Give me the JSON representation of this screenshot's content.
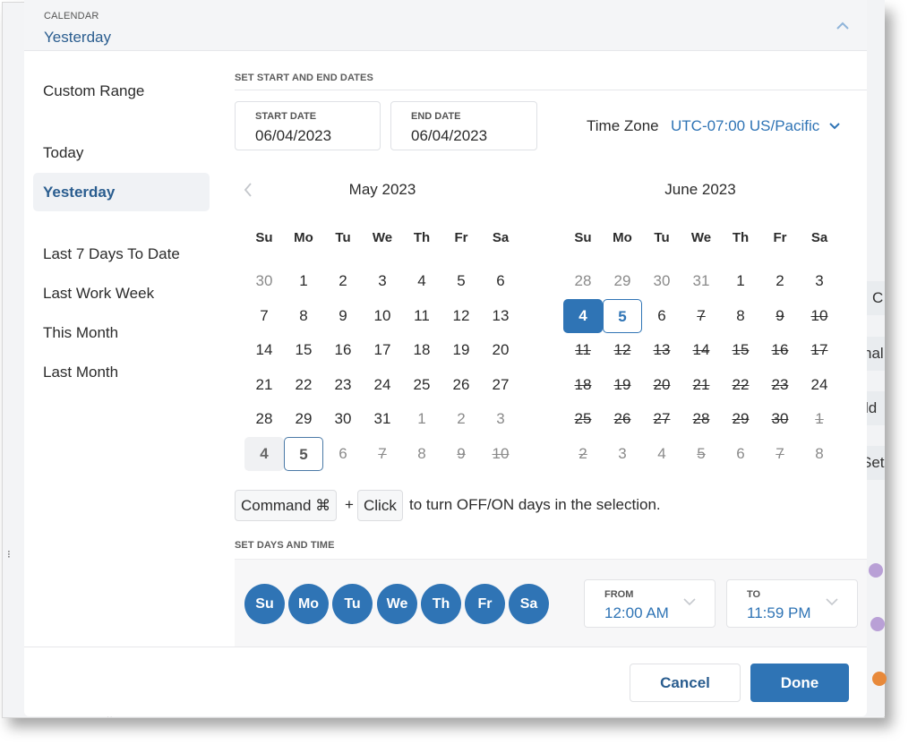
{
  "header": {
    "label": "CALENDAR",
    "value": "Yesterday",
    "collapse_icon": "chevron-up-icon"
  },
  "sidebar": {
    "items": [
      {
        "label": "Custom Range",
        "active": false
      },
      {
        "label": "Today",
        "active": false
      },
      {
        "label": "Yesterday",
        "active": true
      },
      {
        "label": "Last 7 Days To Date",
        "active": false
      },
      {
        "label": "Last Work Week",
        "active": false
      },
      {
        "label": "This Month",
        "active": false
      },
      {
        "label": "Last Month",
        "active": false
      }
    ]
  },
  "dates": {
    "section_label": "SET START AND END DATES",
    "start": {
      "label": "START DATE",
      "value": "06/04/2023"
    },
    "end": {
      "label": "END DATE",
      "value": "06/04/2023"
    },
    "timezone": {
      "label": "Time Zone",
      "value": "UTC-07:00 US/Pacific",
      "icon": "chevron-down-icon"
    },
    "prev_icon": "chevron-left-icon"
  },
  "calendars": [
    {
      "title": "May 2023",
      "weekdays": [
        "Su",
        "Mo",
        "Tu",
        "We",
        "Th",
        "Fr",
        "Sa"
      ],
      "weeks": [
        [
          {
            "d": "30",
            "s": "muted"
          },
          {
            "d": "1"
          },
          {
            "d": "2"
          },
          {
            "d": "3"
          },
          {
            "d": "4"
          },
          {
            "d": "5"
          },
          {
            "d": "6"
          }
        ],
        [
          {
            "d": "7"
          },
          {
            "d": "8"
          },
          {
            "d": "9"
          },
          {
            "d": "10"
          },
          {
            "d": "11"
          },
          {
            "d": "12"
          },
          {
            "d": "13"
          }
        ],
        [
          {
            "d": "14"
          },
          {
            "d": "15"
          },
          {
            "d": "16"
          },
          {
            "d": "17"
          },
          {
            "d": "18"
          },
          {
            "d": "19"
          },
          {
            "d": "20"
          }
        ],
        [
          {
            "d": "21"
          },
          {
            "d": "22"
          },
          {
            "d": "23"
          },
          {
            "d": "24"
          },
          {
            "d": "25"
          },
          {
            "d": "26"
          },
          {
            "d": "27"
          }
        ],
        [
          {
            "d": "28"
          },
          {
            "d": "29"
          },
          {
            "d": "30"
          },
          {
            "d": "31"
          },
          {
            "d": "1",
            "s": "muted"
          },
          {
            "d": "2",
            "s": "muted"
          },
          {
            "d": "3",
            "s": "muted"
          }
        ],
        [
          {
            "d": "4",
            "s": "shade"
          },
          {
            "d": "5",
            "s": "outline-dark"
          },
          {
            "d": "6",
            "s": "muted"
          },
          {
            "d": "7",
            "s": "muted struck"
          },
          {
            "d": "8",
            "s": "muted"
          },
          {
            "d": "9",
            "s": "muted struck"
          },
          {
            "d": "10",
            "s": "muted struck"
          }
        ]
      ]
    },
    {
      "title": "June 2023",
      "weekdays": [
        "Su",
        "Mo",
        "Tu",
        "We",
        "Th",
        "Fr",
        "Sa"
      ],
      "weeks": [
        [
          {
            "d": "28",
            "s": "muted"
          },
          {
            "d": "29",
            "s": "muted"
          },
          {
            "d": "30",
            "s": "muted"
          },
          {
            "d": "31",
            "s": "muted"
          },
          {
            "d": "1"
          },
          {
            "d": "2"
          },
          {
            "d": "3"
          }
        ],
        [
          {
            "d": "4",
            "s": "sel-fill"
          },
          {
            "d": "5",
            "s": "sel-outline"
          },
          {
            "d": "6"
          },
          {
            "d": "7",
            "s": "struck"
          },
          {
            "d": "8"
          },
          {
            "d": "9",
            "s": "struck"
          },
          {
            "d": "10",
            "s": "struck"
          }
        ],
        [
          {
            "d": "11",
            "s": "struck"
          },
          {
            "d": "12",
            "s": "struck"
          },
          {
            "d": "13",
            "s": "struck"
          },
          {
            "d": "14",
            "s": "struck"
          },
          {
            "d": "15",
            "s": "struck"
          },
          {
            "d": "16",
            "s": "struck"
          },
          {
            "d": "17",
            "s": "struck"
          }
        ],
        [
          {
            "d": "18",
            "s": "struck"
          },
          {
            "d": "19",
            "s": "struck"
          },
          {
            "d": "20",
            "s": "struck"
          },
          {
            "d": "21",
            "s": "struck"
          },
          {
            "d": "22",
            "s": "struck"
          },
          {
            "d": "23",
            "s": "struck"
          },
          {
            "d": "24"
          }
        ],
        [
          {
            "d": "25",
            "s": "struck"
          },
          {
            "d": "26",
            "s": "struck"
          },
          {
            "d": "27",
            "s": "struck"
          },
          {
            "d": "28",
            "s": "struck"
          },
          {
            "d": "29",
            "s": "struck"
          },
          {
            "d": "30",
            "s": "struck"
          },
          {
            "d": "1",
            "s": "muted struck"
          }
        ],
        [
          {
            "d": "2",
            "s": "muted struck"
          },
          {
            "d": "3",
            "s": "muted"
          },
          {
            "d": "4",
            "s": "muted"
          },
          {
            "d": "5",
            "s": "muted struck"
          },
          {
            "d": "6",
            "s": "muted"
          },
          {
            "d": "7",
            "s": "muted struck"
          },
          {
            "d": "8",
            "s": "muted"
          }
        ]
      ]
    }
  ],
  "hint": {
    "key1": "Command ⌘",
    "plus": "+",
    "key2": "Click",
    "text": "to turn OFF/ON days in the selection."
  },
  "days_time": {
    "section_label": "SET DAYS AND TIME",
    "days": [
      "Su",
      "Mo",
      "Tu",
      "We",
      "Th",
      "Fr",
      "Sa"
    ],
    "from": {
      "label": "FROM",
      "value": "12:00 AM"
    },
    "to": {
      "label": "TO",
      "value": "11:59 PM"
    }
  },
  "footer": {
    "cancel": "Cancel",
    "done": "Done"
  },
  "background": {
    "row_texts": [
      "C",
      "nal",
      "ld",
      "Set"
    ],
    "dot_colors": [
      "#b9a0d6",
      "#b9a0d6",
      "#e8893a"
    ]
  },
  "colors": {
    "accent": "#2f74b5",
    "header_text": "#2a5d8f"
  }
}
